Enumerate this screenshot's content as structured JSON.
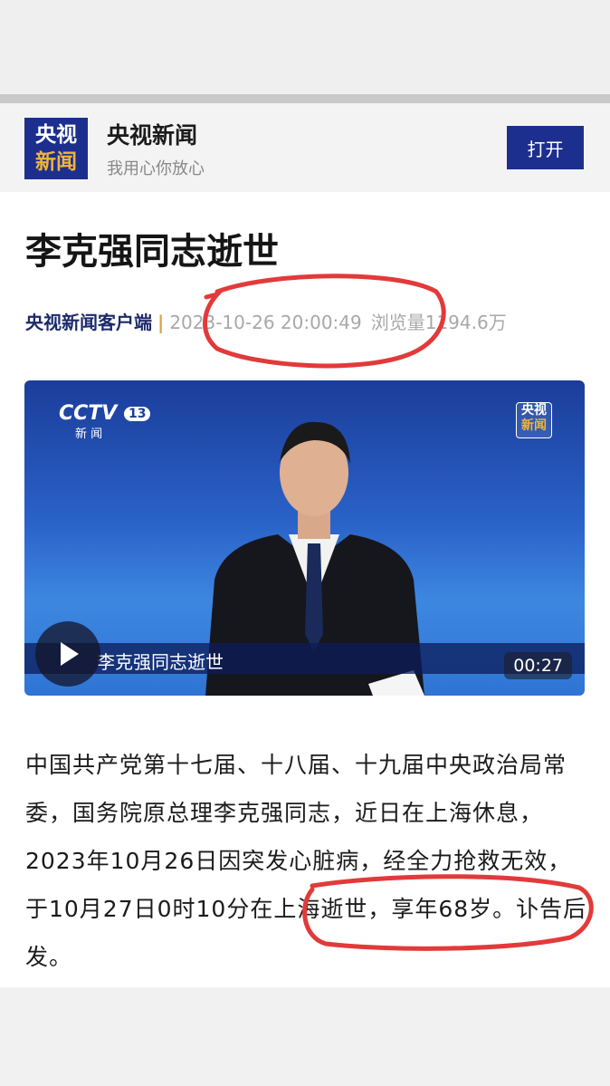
{
  "app": {
    "name": "央视新闻",
    "slogan": "我用心你放心",
    "open_button": "打开",
    "logo_line1": "央视",
    "logo_line2": "新闻"
  },
  "article": {
    "title": "李克强同志逝世",
    "source": "央视新闻客户端",
    "separator": "|",
    "datetime": "2023-10-26 20:00:49",
    "views": "浏览量1194.6万",
    "body": "中国共产党第十七届、十八届、十九届中央政治局常委，国务院原总理李克强同志，近日在上海休息，2023年10月26日因突发心脏病，经全力抢救无效，于10月27日0时10分在上海逝世，享年68岁。讣告后发。"
  },
  "video": {
    "caption": "李克强同志逝世",
    "duration": "00:27",
    "channel_logo": "CCTV",
    "channel_number": "13",
    "channel_sub": "新 闻",
    "bug_line1": "央视",
    "bug_line2": "新闻"
  },
  "colors": {
    "brand": "#1c2f8f",
    "accent": "#f0b43a",
    "annotation": "#e23a3a"
  }
}
